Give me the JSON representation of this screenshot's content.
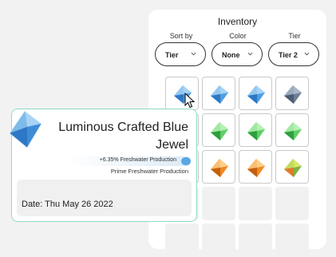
{
  "inventory": {
    "title": "Inventory",
    "filters": [
      {
        "label": "Sort by",
        "value": "Tier"
      },
      {
        "label": "Color",
        "value": "None"
      },
      {
        "label": "Tier",
        "value": "Tier 2"
      }
    ],
    "cells": [
      {
        "gem": "blue"
      },
      {
        "gem": "blue"
      },
      {
        "gem": "blue"
      },
      {
        "gem": "slate"
      },
      {
        "gem": "green"
      },
      {
        "gem": "green"
      },
      {
        "gem": "green"
      },
      {
        "gem": "green"
      },
      {
        "gem": "orange"
      },
      {
        "gem": "orange"
      },
      {
        "gem": "orange"
      },
      {
        "gem": "mixed"
      },
      {
        "gem": "none"
      },
      {
        "gem": "none"
      },
      {
        "gem": "none"
      },
      {
        "gem": "none"
      },
      {
        "gem": "none"
      },
      {
        "gem": "none"
      },
      {
        "gem": "none"
      },
      {
        "gem": "none"
      }
    ]
  },
  "tooltip": {
    "name": "Luminous Crafted Blue Jewel",
    "bonus": "+6.35% Freshwater Production",
    "subtitle": "Prime Freshwater Production",
    "date": "Date: Thu May 26 2022",
    "icon": "blue-jewel-icon"
  },
  "colors": {
    "blue": [
      "#a9d3f5",
      "#4f9ee0",
      "#2d78c4"
    ],
    "slate": [
      "#a9b8c8",
      "#6b7f95",
      "#4b5d72"
    ],
    "green": [
      "#b5f0b5",
      "#5fcf66",
      "#2f9e3e"
    ],
    "orange": [
      "#ffcf8a",
      "#f08a24",
      "#c2600f"
    ],
    "mixed": [
      "#d9e86a",
      "#7cb342",
      "#e07a2a"
    ],
    "accent": "#8fd9c8"
  }
}
